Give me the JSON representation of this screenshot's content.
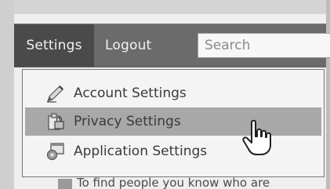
{
  "nav": {
    "settings_label": "Settings",
    "logout_label": "Logout",
    "search_placeholder": "Search"
  },
  "menu": {
    "items": [
      {
        "label": "Account Settings",
        "icon": "pencil-icon"
      },
      {
        "label": "Privacy Settings",
        "icon": "clipboard-lock-icon",
        "highlighted": true
      },
      {
        "label": "Application Settings",
        "icon": "application-icon"
      }
    ]
  },
  "background": {
    "partial_text": "To find people you know who are"
  },
  "colors": {
    "topbar": "#6b6b6b",
    "active_tab": "#4a4a4a",
    "highlight": "#a8a8a8"
  }
}
